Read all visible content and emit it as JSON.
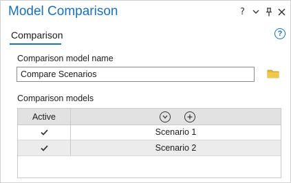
{
  "pane": {
    "title": "Model Comparison",
    "controls": {
      "help_glyph": "?",
      "options_icon": "chevron-down-icon",
      "pin_icon": "pin-icon",
      "close_icon": "close-icon"
    }
  },
  "tabs": [
    {
      "label": "Comparison",
      "selected": true
    }
  ],
  "help_icon": {
    "glyph": "?"
  },
  "form": {
    "name_label": "Comparison model name",
    "name_value": "Compare Scenarios",
    "browse_icon": "folder-icon",
    "models_label": "Comparison models"
  },
  "grid": {
    "header": {
      "active_label": "Active",
      "actions": [
        "expand-circle-down-icon",
        "add-circle-icon"
      ]
    },
    "rows": [
      {
        "active": true,
        "name": "Scenario 1"
      },
      {
        "active": true,
        "name": "Scenario 2"
      }
    ]
  },
  "colors": {
    "accent": "#1b6fb5",
    "folder": "#e2b93b",
    "header_bg": "#e2e2e2"
  }
}
